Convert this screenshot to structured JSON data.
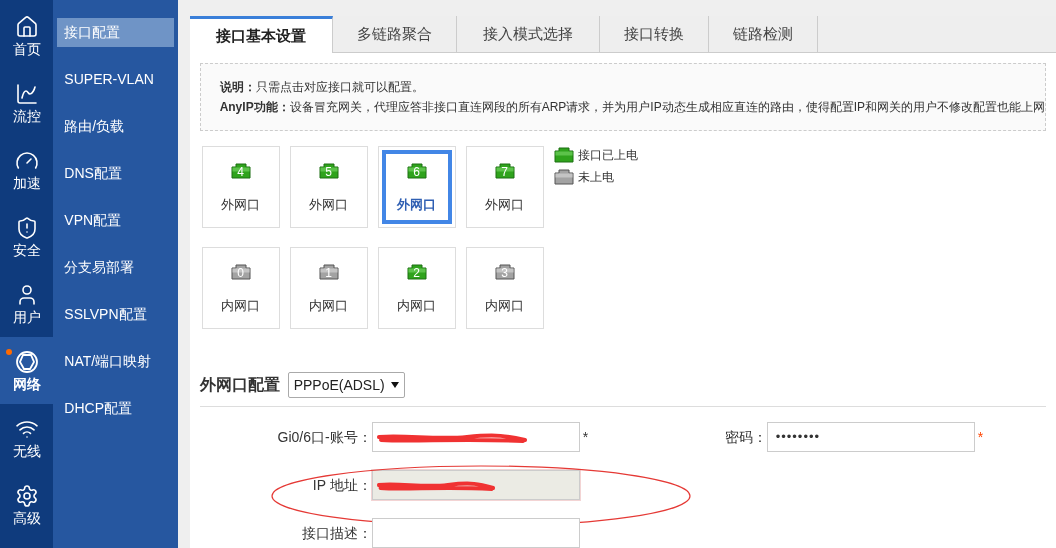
{
  "nav_rail": [
    {
      "label": "首页",
      "selected": false,
      "dot": false
    },
    {
      "label": "流控",
      "selected": false,
      "dot": false
    },
    {
      "label": "加速",
      "selected": false,
      "dot": false
    },
    {
      "label": "安全",
      "selected": false,
      "dot": false
    },
    {
      "label": "用户",
      "selected": false,
      "dot": false
    },
    {
      "label": "网络",
      "selected": true,
      "dot": true
    },
    {
      "label": "无线",
      "selected": false,
      "dot": false
    },
    {
      "label": "高级",
      "selected": false,
      "dot": false
    }
  ],
  "submenu": [
    {
      "label": "接口配置",
      "selected": true
    },
    {
      "label": "SUPER-VLAN",
      "selected": false
    },
    {
      "label": "路由/负载",
      "selected": false
    },
    {
      "label": "DNS配置",
      "selected": false
    },
    {
      "label": "VPN配置",
      "selected": false
    },
    {
      "label": "分支易部署",
      "selected": false
    },
    {
      "label": "SSLVPN配置",
      "selected": false
    },
    {
      "label": "NAT/端口映射",
      "selected": false
    },
    {
      "label": "DHCP配置",
      "selected": false
    }
  ],
  "tabs": [
    {
      "label": "接口基本设置",
      "selected": true
    },
    {
      "label": "多链路聚合",
      "selected": false
    },
    {
      "label": "接入模式选择",
      "selected": false
    },
    {
      "label": "接口转换",
      "selected": false
    },
    {
      "label": "链路检测",
      "selected": false
    }
  ],
  "notes": [
    {
      "label": "说明：",
      "text": "只需点击对应接口就可以配置。"
    },
    {
      "label": "AnyIP功能：",
      "text": "设备冒充网关，代理应答非接口直连网段的所有ARP请求，并为用户IP动态生成相应直连的路由，使得配置IP和网关的用户不修改配置也能上网"
    }
  ],
  "port_rows": [
    [
      {
        "number": "4",
        "label": "外网口",
        "powered": true,
        "selected": false
      },
      {
        "number": "5",
        "label": "外网口",
        "powered": true,
        "selected": false
      },
      {
        "number": "6",
        "label": "外网口",
        "powered": true,
        "selected": true
      },
      {
        "number": "7",
        "label": "外网口",
        "powered": true,
        "selected": false
      }
    ],
    [
      {
        "number": "0",
        "label": "内网口",
        "powered": false,
        "selected": false
      },
      {
        "number": "1",
        "label": "内网口",
        "powered": false,
        "selected": false
      },
      {
        "number": "2",
        "label": "内网口",
        "powered": true,
        "selected": false
      },
      {
        "number": "3",
        "label": "内网口",
        "powered": false,
        "selected": false
      }
    ]
  ],
  "legend": [
    {
      "label": "接口已上电",
      "powered": true
    },
    {
      "label": "未上电",
      "powered": false
    }
  ],
  "section": {
    "title": "外网口配置",
    "mode": "PPPoE(ADSL)"
  },
  "form_rows": [
    [
      {
        "label": "Gi0/6口-账号：",
        "kind": "text",
        "redacted": true,
        "required_mark": "*",
        "mark_alert": false,
        "circled": false
      },
      {
        "label": "密码：",
        "kind": "password",
        "value": "••••••••",
        "redacted": false,
        "required_mark": "*",
        "mark_alert": true,
        "circled": false
      }
    ],
    [
      {
        "label": "IP 地址：",
        "kind": "readonly",
        "redacted": true,
        "circled": true
      }
    ],
    [
      {
        "label": "接口描述：",
        "kind": "text",
        "redacted": false,
        "circled": false
      }
    ]
  ]
}
